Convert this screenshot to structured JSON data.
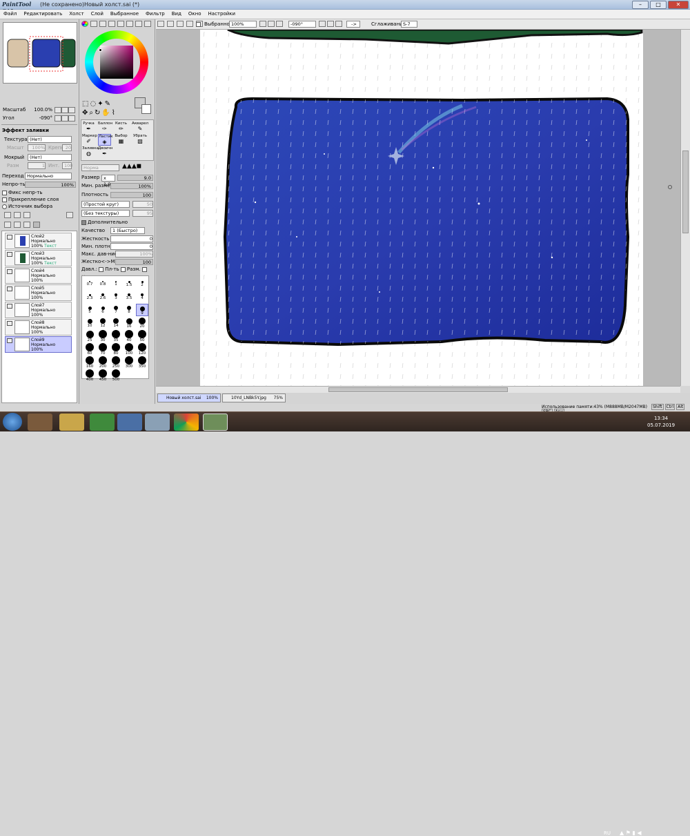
{
  "titlebar": {
    "app": "PaintTool SAI",
    "title": "(Не сохранено)Новый холст.sai (*)",
    "minimize": "–",
    "maximize": "□",
    "close": "✕"
  },
  "menu": [
    "Файл",
    "Редактировать",
    "Холст",
    "Слой",
    "Выбранное",
    "Фильтр",
    "Вид",
    "Окно",
    "Настройки"
  ],
  "nav": {
    "scale_label": "Масштаб",
    "scale_value": "100.0%",
    "angle_label": "Угол",
    "angle_value": "-090°"
  },
  "fill_effect": {
    "title": "Эффект заливки",
    "texture_label": "Текстура",
    "texture_value": "(Нет)",
    "scale_label": "Масшт",
    "scale_value": "100%",
    "strength_label": "Крепк",
    "strength_value": "20",
    "wet_label": "Мокрый",
    "wet_value": "(Нет)",
    "ratio_label": "Разм",
    "ratio_value": "1",
    "intensity_label": "Инт.",
    "intensity_value": "100"
  },
  "layer_props": {
    "blend_label": "Переход",
    "blend_value": "Нормально",
    "opacity_label": "Непро-ть",
    "opacity_value": "100%",
    "fix_opacity": "Фикс непр-ть",
    "clip_layer": "Прикрепление слоя",
    "selection_source": "Источник выбора"
  },
  "layers": [
    {
      "name": "Слой2",
      "mode": "Нормально",
      "opacity": "100%",
      "extra": "Текст"
    },
    {
      "name": "Слой3",
      "mode": "Нормально",
      "opacity": "100%",
      "extra": "Текст"
    },
    {
      "name": "Слой4",
      "mode": "Нормально",
      "opacity": "100%",
      "extra": ""
    },
    {
      "name": "Слой5",
      "mode": "Нормально",
      "opacity": "100%",
      "extra": ""
    },
    {
      "name": "Слой7",
      "mode": "Нормально",
      "opacity": "100%",
      "extra": ""
    },
    {
      "name": "Слой8",
      "mode": "Нормально",
      "opacity": "100%",
      "extra": ""
    },
    {
      "name": "Слой9",
      "mode": "Нормально",
      "opacity": "100%",
      "extra": ""
    }
  ],
  "tools": {
    "row1": [
      "Ручка",
      "Баллон",
      "Кисть",
      "Акварел"
    ],
    "row2": [
      "Маркер",
      "Ластик",
      "Выбор",
      "Убрать"
    ],
    "row3": [
      "Заливка",
      "Двоичн"
    ]
  },
  "brush": {
    "mode": "Норма",
    "size_label": "Размер",
    "size_mult": "х 1.0",
    "size_value": "9.0",
    "min_size_label": "Мин. размер",
    "min_size_value": "100%",
    "density_label": "Плотность",
    "density_value": "100",
    "shape": "(Простой круг)",
    "shape_val": "50",
    "texture": "(Без текстуры)",
    "texture_val": "95",
    "advanced": "Дополнительно",
    "quality_label": "Качество",
    "quality_value": "1 (Быстро)",
    "hardness_label": "Жесткость",
    "hardness_value": "0",
    "min_density_label": "Мин. плотн.",
    "min_density_value": "0",
    "max_pressure_label": "Макс. дав-ние",
    "max_pressure_value": "100%",
    "hard_soft_label": "Жестко<->Мягко",
    "hard_soft_value": "100",
    "pressure_label": "Давл.:",
    "pressure_density": "Пл-ть",
    "pressure_size": "Разм.",
    "pressure_color": "Цвет"
  },
  "brush_sizes": [
    "0.7",
    "0.8",
    "1",
    "1.5",
    "2",
    "2.3",
    "2.6",
    "3",
    "3.5",
    "4",
    "5",
    "6",
    "7",
    "8",
    "9",
    "10",
    "12",
    "14",
    "16",
    "20",
    "25",
    "30",
    "35",
    "40",
    "50",
    "60",
    "70",
    "80",
    "100",
    "120",
    "160",
    "200",
    "250",
    "300",
    "350",
    "400",
    "450",
    "500"
  ],
  "toolbar2": {
    "selection_label": "Выбранное",
    "zoom": "100%",
    "angle": "-090°",
    "arrow": "->",
    "smoothing_label": "Сглаживание",
    "smoothing_value": "S-7"
  },
  "tabs": [
    {
      "name": "Новый холст.sai",
      "zoom": "100%"
    },
    {
      "name": "10Yd_LNBk5Y.jpg",
      "zoom": "75%"
    }
  ],
  "status": {
    "memory": "Использование памяти:43% (М888МВ/М2047МВ)",
    "keys": [
      "Shift",
      "Ctrl",
      "Alt",
      "SPC",
      "Any"
    ]
  },
  "taskbar": {
    "lang": "RU",
    "time": "13:34",
    "date": "05.07.2019"
  },
  "colors": {
    "accent": "#c9ccff",
    "canvas_blue": "#2a3fb0",
    "taskbar": "#3a2d26"
  }
}
